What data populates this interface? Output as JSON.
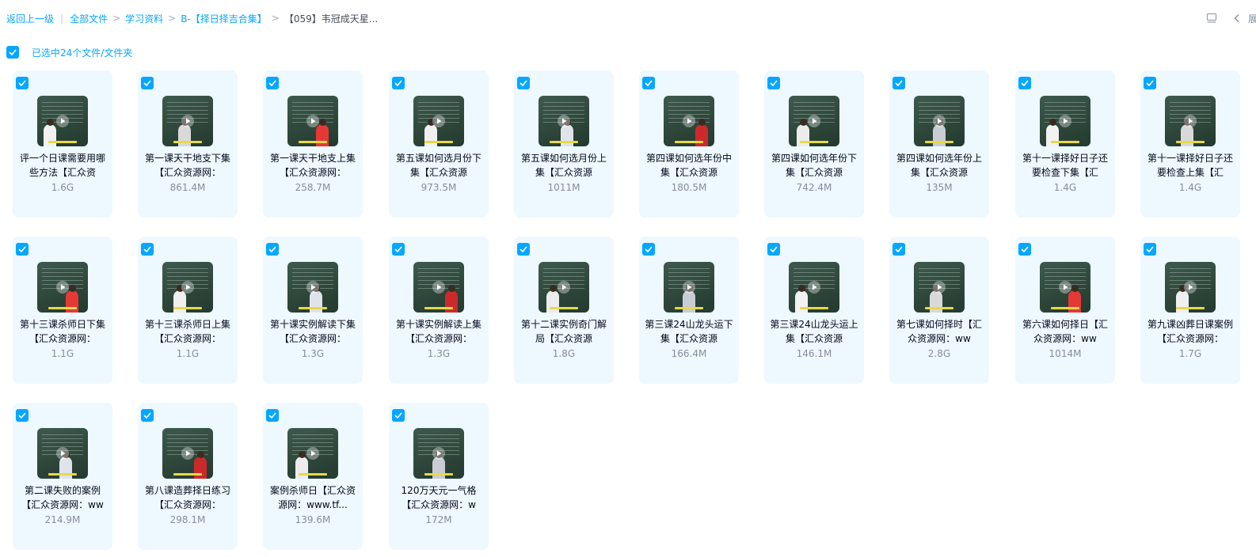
{
  "breadcrumb": {
    "back": "返回上一级",
    "items": [
      "全部文件",
      "学习资料",
      "B-【择日择吉合集】",
      "【059】韦冠成天星..."
    ],
    "separator": ">"
  },
  "toolbar": {
    "expand_label": "展开"
  },
  "selection": {
    "label": "已选中24个文件/文件夹",
    "checked": true
  },
  "colors": {
    "accent": "#06a7ff",
    "card_bg": "#eef8ff",
    "text": "#03081a",
    "muted": "#878c9c"
  },
  "files": [
    {
      "name": "评一个日课需要用哪些方法【汇众资",
      "size": "1.6G",
      "icon": "video-thumbnail"
    },
    {
      "name": "第一课天干地支下集【汇众资源网：",
      "size": "861.4M",
      "icon": "video-thumbnail"
    },
    {
      "name": "第一课天干地支上集【汇众资源网：",
      "size": "258.7M",
      "icon": "video-thumbnail"
    },
    {
      "name": "第五课如何选月份下集【汇众资源",
      "size": "973.5M",
      "icon": "video-thumbnail"
    },
    {
      "name": "第五课如何选月份上集【汇众资源",
      "size": "1011M",
      "icon": "video-thumbnail"
    },
    {
      "name": "第四课如何选年份中集【汇众资源",
      "size": "180.5M",
      "icon": "video-thumbnail"
    },
    {
      "name": "第四课如何选年份下集【汇众资源",
      "size": "742.4M",
      "icon": "video-thumbnail"
    },
    {
      "name": "第四课如何选年份上集【汇众资源",
      "size": "135M",
      "icon": "video-thumbnail"
    },
    {
      "name": "第十一课择好日子还要检查下集【汇",
      "size": "1.4G",
      "icon": "video-thumbnail"
    },
    {
      "name": "第十一课择好日子还要检查上集【汇",
      "size": "1.4G",
      "icon": "video-thumbnail"
    },
    {
      "name": "第十三课杀师日下集【汇众资源网：",
      "size": "1.1G",
      "icon": "video-thumbnail"
    },
    {
      "name": "第十三课杀师日上集【汇众资源网：",
      "size": "1.1G",
      "icon": "video-thumbnail"
    },
    {
      "name": "第十课实例解读下集【汇众资源网：",
      "size": "1.3G",
      "icon": "video-thumbnail"
    },
    {
      "name": "第十课实例解读上集【汇众资源网：",
      "size": "1.3G",
      "icon": "video-thumbnail"
    },
    {
      "name": "第十二课实例奇门解局【汇众资源",
      "size": "1.8G",
      "icon": "video-thumbnail"
    },
    {
      "name": "第三课24山龙头运下集【汇众资源",
      "size": "166.4M",
      "icon": "video-thumbnail"
    },
    {
      "name": "第三课24山龙头运上集【汇众资源",
      "size": "146.1M",
      "icon": "video-thumbnail"
    },
    {
      "name": "第七课如何择时【汇众资源网：ww",
      "size": "2.8G",
      "icon": "video-thumbnail"
    },
    {
      "name": "第六课如何择日【汇众资源网：ww",
      "size": "1014M",
      "icon": "video-thumbnail"
    },
    {
      "name": "第九课凶葬日课案例【汇众资源网：",
      "size": "1.7G",
      "icon": "video-thumbnail"
    },
    {
      "name": "第二课失败的案例【汇众资源网：ww",
      "size": "214.9M",
      "icon": "video-thumbnail"
    },
    {
      "name": "第八课造葬择日练习【汇众资源网：",
      "size": "298.1M",
      "icon": "video-thumbnail"
    },
    {
      "name": "案例杀师日【汇众资源网：www.tf...",
      "size": "139.6M",
      "icon": "video-thumbnail"
    },
    {
      "name": "120万天元一气格【汇众资源网：w",
      "size": "172M",
      "icon": "video-thumbnail"
    }
  ]
}
